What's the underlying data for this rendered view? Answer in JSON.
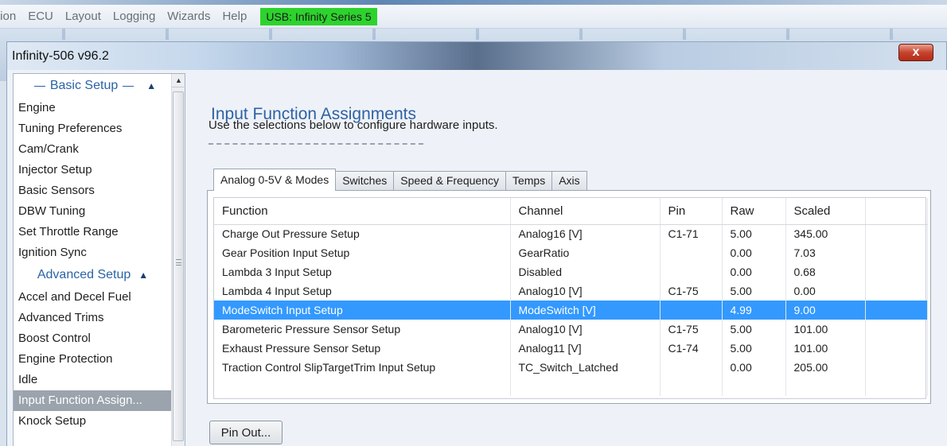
{
  "menu": {
    "items": [
      "tion",
      "ECU",
      "Layout",
      "Logging",
      "Wizards",
      "Help"
    ],
    "usb_status": "USB: Infinity Series 5"
  },
  "window": {
    "title": "Infinity-506 v96.2",
    "close_glyph": "x"
  },
  "sidebar": {
    "basic_header": "Basic Setup",
    "basic_items": [
      "Engine",
      "Tuning Preferences",
      "Cam/Crank",
      "Injector Setup",
      "Basic Sensors",
      "DBW Tuning",
      "Set Throttle Range",
      "Ignition Sync"
    ],
    "advanced_header": "Advanced Setup",
    "advanced_items": [
      "Accel and Decel Fuel",
      "Advanced Trims",
      "Boost Control",
      "Engine Protection",
      "Idle",
      "Input Function Assign...",
      "Knock Setup"
    ],
    "selected_item": "Input Function Assign..."
  },
  "main": {
    "title": "Input Function Assignments",
    "description": "Use the selections below to configure hardware inputs.",
    "tabs": [
      {
        "label": "Analog 0-5V & Modes",
        "active": true
      },
      {
        "label": "Switches",
        "active": false
      },
      {
        "label": "Speed & Frequency",
        "active": false
      },
      {
        "label": "Temps",
        "active": false
      },
      {
        "label": "Axis",
        "active": false
      }
    ],
    "table": {
      "columns": [
        "Function",
        "Channel",
        "Pin",
        "Raw",
        "Scaled",
        ""
      ],
      "rows": [
        [
          "Charge Out Pressure Setup",
          "Analog16 [V]",
          "C1-71",
          "5.00",
          "345.00"
        ],
        [
          "Gear Position Input Setup",
          "GearRatio",
          "",
          "0.00",
          "7.03"
        ],
        [
          "Lambda 3 Input Setup",
          "Disabled",
          "",
          "0.00",
          "0.68"
        ],
        [
          "Lambda 4 Input Setup",
          "Analog10 [V]",
          "C1-75",
          "5.00",
          "0.00"
        ],
        [
          "ModeSwitch Input Setup",
          "ModeSwitch [V]",
          "",
          "4.99",
          "9.00"
        ],
        [
          "Barometeric Pressure Sensor Setup",
          "Analog10 [V]",
          "C1-75",
          "5.00",
          "101.00"
        ],
        [
          "Exhaust Pressure Sensor Setup",
          "Analog11 [V]",
          "C1-74",
          "5.00",
          "101.00"
        ],
        [
          "Traction Control SlipTargetTrim Input Setup",
          "TC_Switch_Latched",
          "",
          "0.00",
          "205.00"
        ]
      ],
      "selected_row": 4
    },
    "pin_out_label": "Pin Out..."
  },
  "colors": {
    "accent_text": "#2f62a3",
    "usb_status_bg": "#2dd32d",
    "selection": "#3399ff",
    "sidebar_selected": "#9ba3ad"
  }
}
